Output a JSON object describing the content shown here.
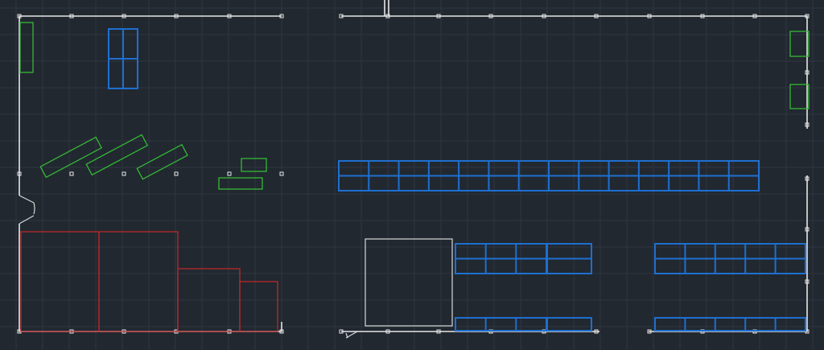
{
  "drawing": {
    "background": "#212830",
    "grid_color": "#2e3640",
    "wall_color": "#e6e6e6",
    "layer_colors": {
      "storage_racks": "#1e6fd0",
      "furniture": "#35b835",
      "zones": "#c42a2a",
      "equipment": "#d8d8d8"
    }
  }
}
